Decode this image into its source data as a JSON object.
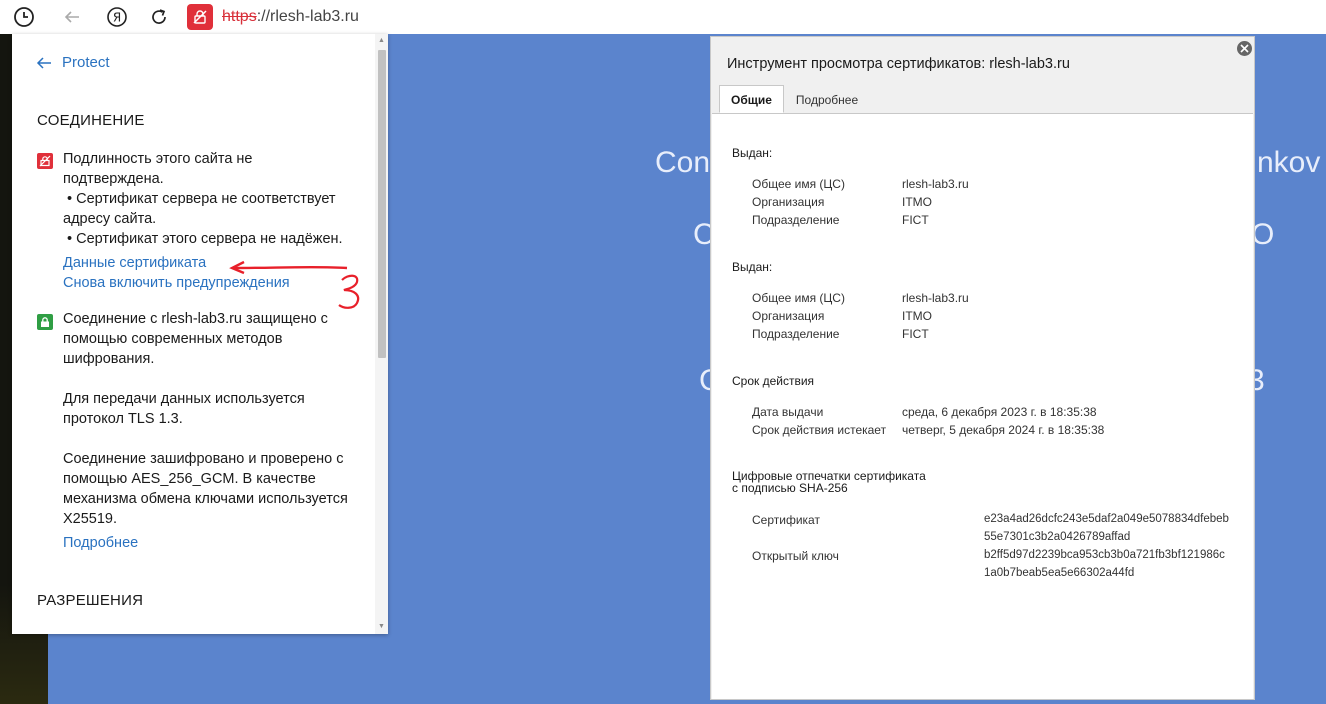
{
  "address_bar": {
    "protocol": "https",
    "host_part": "://rlesh-lab3.ru"
  },
  "background_page": {
    "line1": "Con",
    "line1_right": "nkov",
    "line2": "C",
    "line2_right": "O",
    "line3": "C",
    "line3_right": "3"
  },
  "site_info": {
    "back_label": "Protect",
    "connection_heading": "СОЕДИНЕНИЕ",
    "warning_lines": [
      "Подлинность этого сайта не",
      "подтверждена.",
      " • Сертификат сервера не соответствует",
      "адресу сайта.",
      " • Сертификат этого сервера не надёжен."
    ],
    "cert_link": "Данные сертификата",
    "reenable_link": "Снова включить предупреждения",
    "secure_lines": [
      "Соединение с rlesh-lab3.ru защищено с",
      "помощью современных методов",
      "шифрования."
    ],
    "tls_lines": [
      "Для передачи данных используется",
      "протокол TLS 1.3."
    ],
    "cipher_lines": [
      "Соединение зашифровано и проверено с",
      "помощью AES_256_GCM. В качестве",
      "механизма обмена ключами используется",
      "X25519."
    ],
    "more_link": "Подробнее",
    "permissions_heading": "РАЗРЕШЕНИЯ"
  },
  "cert_viewer": {
    "title": "Инструмент просмотра сертификатов: rlesh-lab3.ru",
    "tabs": [
      "Общие",
      "Подробнее"
    ],
    "issued_to": {
      "heading": "Выдан:",
      "rows": [
        {
          "key": "Общее имя (ЦС)",
          "value": "rlesh-lab3.ru"
        },
        {
          "key": "Организация",
          "value": "ITMO"
        },
        {
          "key": "Подразделение",
          "value": "FICT"
        }
      ]
    },
    "issued_by": {
      "heading": "Выдан:",
      "rows": [
        {
          "key": "Общее имя (ЦС)",
          "value": "rlesh-lab3.ru"
        },
        {
          "key": "Организация",
          "value": "ITMO"
        },
        {
          "key": "Подразделение",
          "value": "FICT"
        }
      ]
    },
    "validity": {
      "heading": "Срок действия",
      "rows": [
        {
          "key": "Дата выдачи",
          "value": "среда, 6 декабря 2023 г. в 18:35:38"
        },
        {
          "key": "Срок действия истекает",
          "value": "четверг, 5 декабря 2024 г. в 18:35:38"
        }
      ]
    },
    "fingerprints": {
      "heading_line1": "Цифровые отпечатки сертификата",
      "heading_line2": "с подписью SHA-256",
      "cert_label": "Сертификат",
      "cert_line1": "e23a4ad26dcfc243e5daf2a049e5078834dfebeb",
      "cert_line2": "55e7301c3b2a0426789affad",
      "key_label": "Открытый ключ",
      "key_line1": "b2ff5d97d2239bca953cb3b0a721fb3bf121986c",
      "key_line2": "1a0b7beab5ea5e66302a44fd"
    }
  },
  "colors": {
    "page_bg": "#5b84cd",
    "link": "#2a72c0",
    "danger": "#e0303a",
    "secure": "#2f9e44",
    "annotation": "#e8202a"
  }
}
